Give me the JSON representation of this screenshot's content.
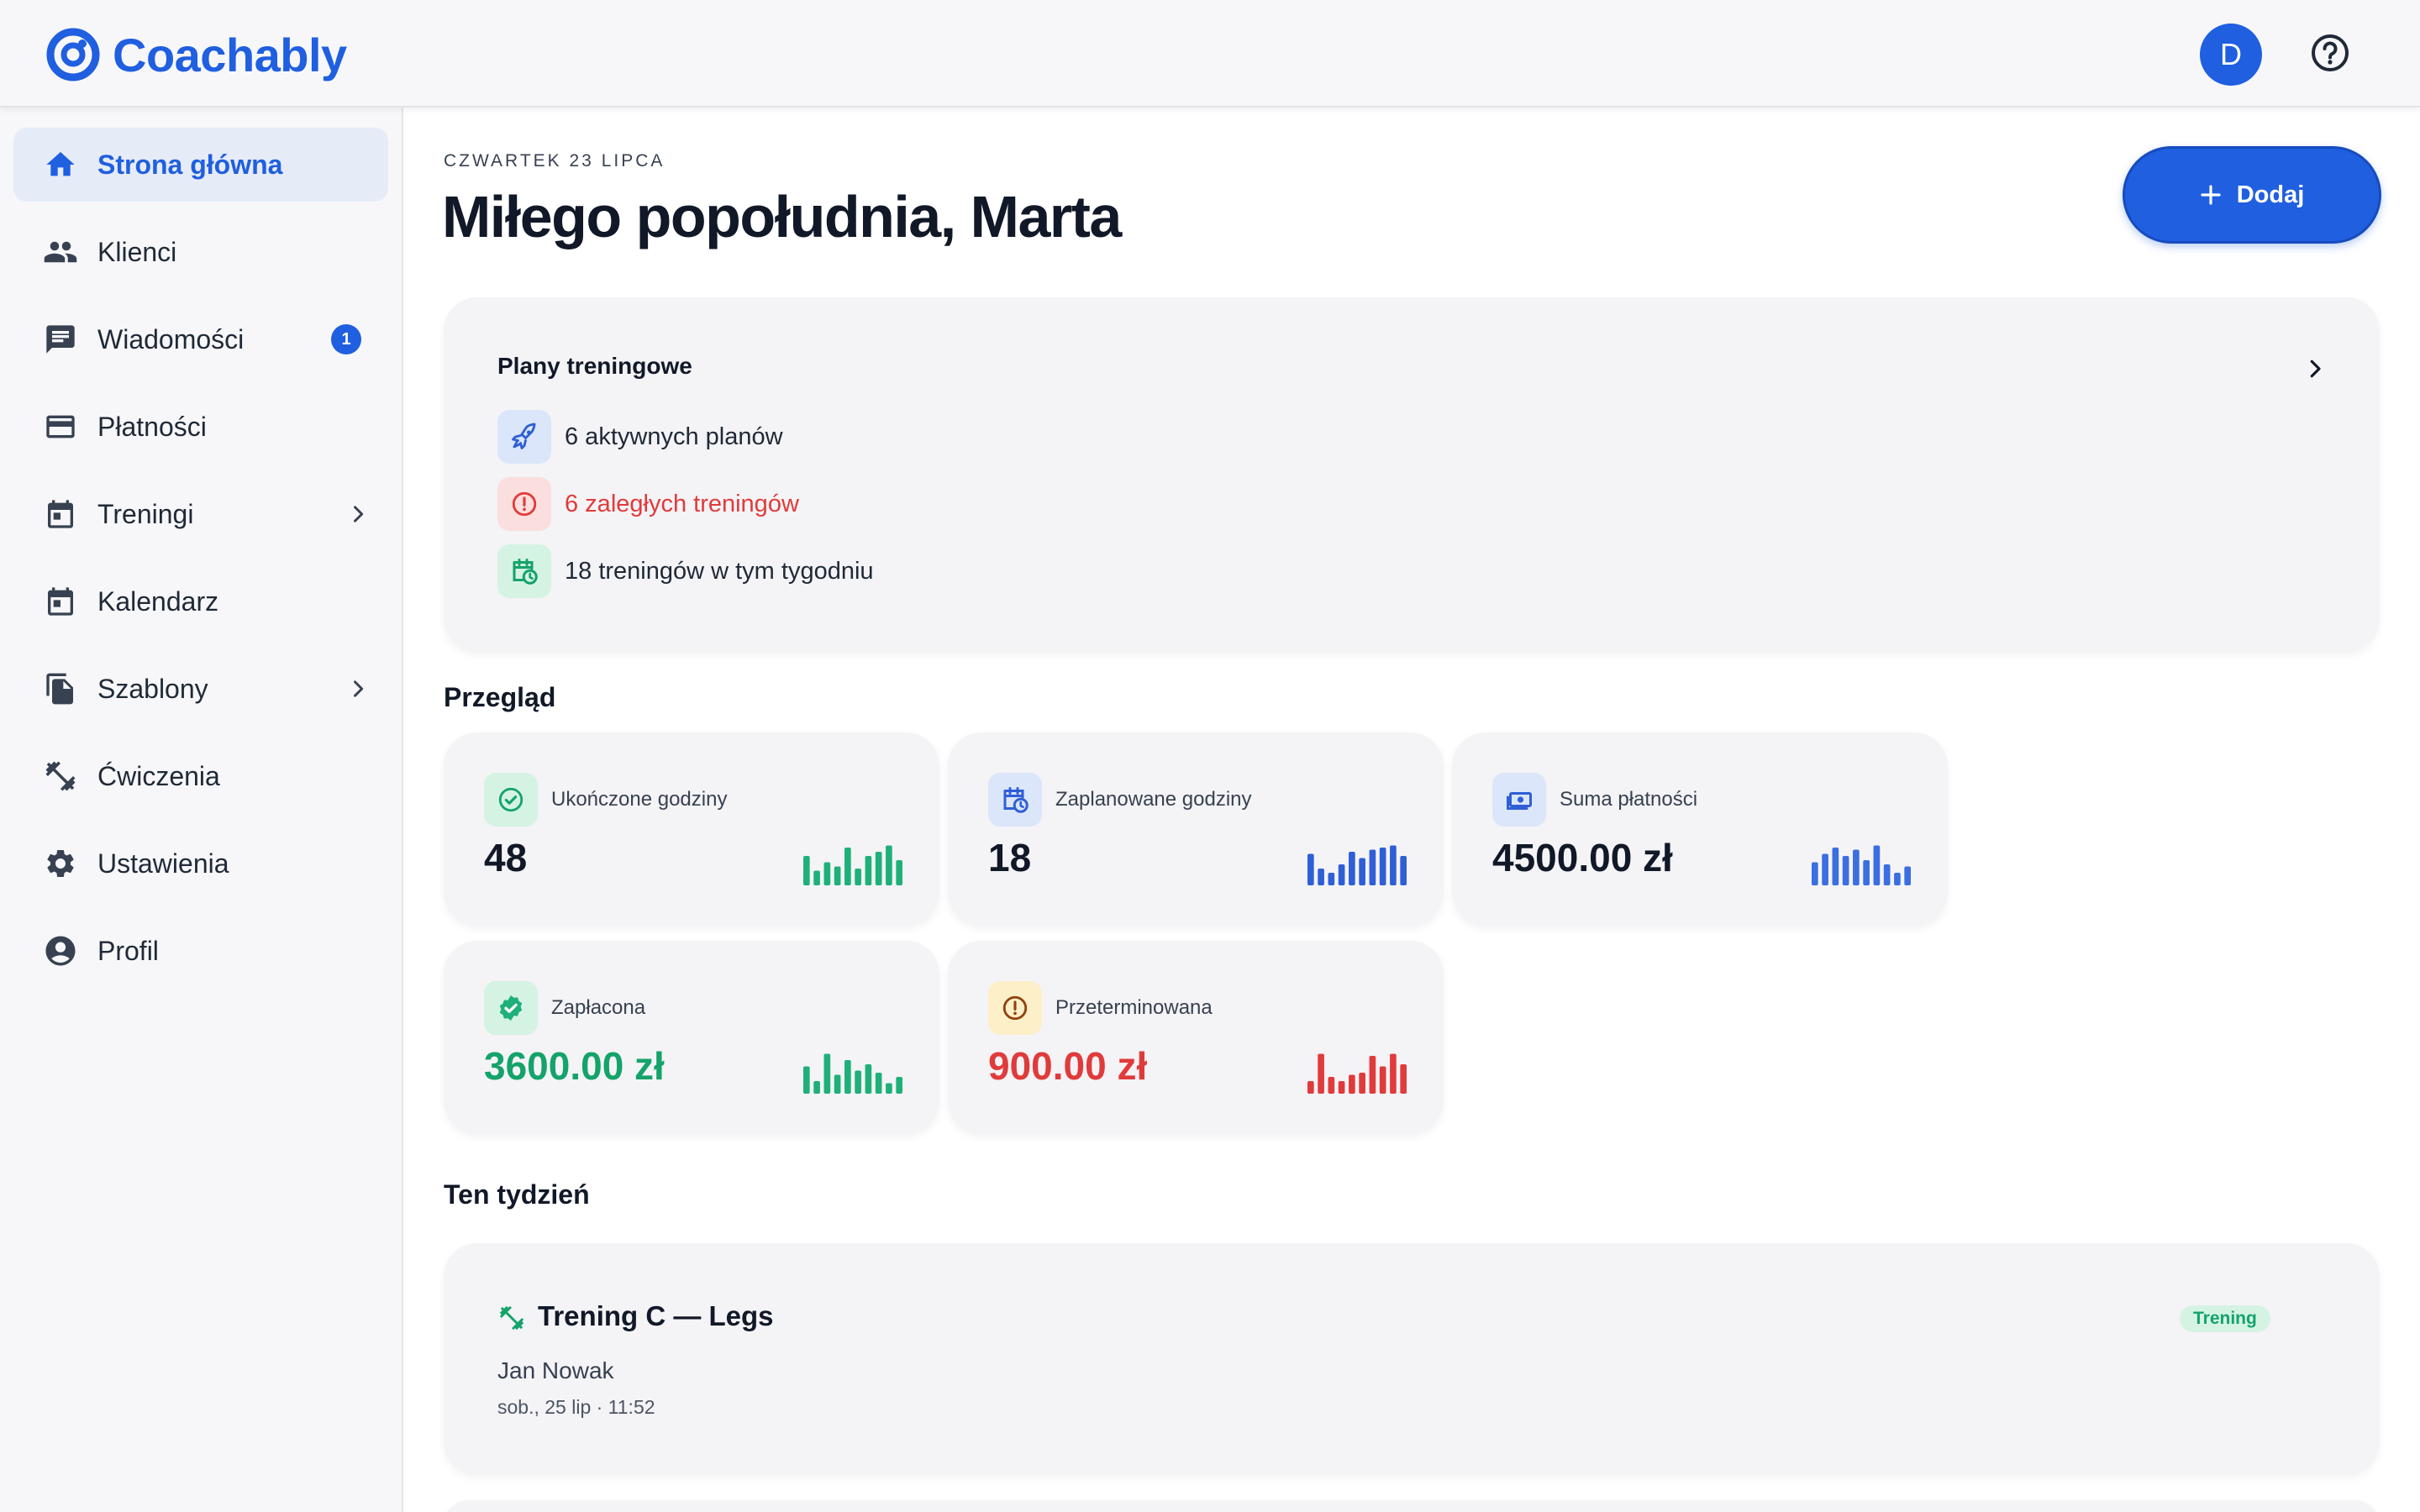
{
  "app": {
    "name": "Coachably",
    "user_initial": "D"
  },
  "colors": {
    "brand": "#1f5fe0",
    "success": "#14a36a",
    "danger": "#e03b3b",
    "warning": "#b45309"
  },
  "sidebar": {
    "items": [
      {
        "label": "Strona główna",
        "icon": "home-icon",
        "active": true
      },
      {
        "label": "Klienci",
        "icon": "people-icon"
      },
      {
        "label": "Wiadomości",
        "icon": "message-icon",
        "badge": "1"
      },
      {
        "label": "Płatności",
        "icon": "credit-card-icon"
      },
      {
        "label": "Treningi",
        "icon": "calendar-icon",
        "expandable": true
      },
      {
        "label": "Kalendarz",
        "icon": "calendar-icon"
      },
      {
        "label": "Szablony",
        "icon": "copy-icon",
        "expandable": true
      },
      {
        "label": "Ćwiczenia",
        "icon": "dumbbell-icon"
      },
      {
        "label": "Ustawienia",
        "icon": "gear-icon"
      },
      {
        "label": "Profil",
        "icon": "account-icon"
      }
    ]
  },
  "header": {
    "date": "CZWARTEK 23 LIPCA",
    "greeting": "Miłego popołudnia, Marta",
    "add_label": "Dodaj"
  },
  "plans": {
    "title": "Plany treningowe",
    "rows": [
      {
        "text": "6 aktywnych planów",
        "icon": "rocket-icon"
      },
      {
        "text": "6 zaległych treningów",
        "icon": "alert-circle-icon"
      },
      {
        "text": "18 treningów w tym tygodniu",
        "icon": "calendar-clock-icon"
      }
    ]
  },
  "overview": {
    "title": "Przegląd",
    "stats": [
      {
        "label": "Ukończone godziny",
        "value": "48",
        "icon": "check-circle-icon",
        "color": "#1fb07a",
        "spark": [
          0.7,
          0.35,
          0.55,
          0.45,
          0.9,
          0.4,
          0.7,
          0.8,
          0.95,
          0.6
        ]
      },
      {
        "label": "Zaplanowane godziny",
        "value": "18",
        "icon": "calendar-clock-icon",
        "color": "#2f5fd6",
        "spark": [
          0.75,
          0.4,
          0.3,
          0.5,
          0.8,
          0.65,
          0.85,
          0.9,
          0.95,
          0.7
        ]
      },
      {
        "label": "Suma płatności",
        "value": "4500.00 zł",
        "icon": "money-icon",
        "color": "#3b6ee0",
        "spark": [
          0.55,
          0.75,
          0.9,
          0.7,
          0.85,
          0.6,
          0.95,
          0.5,
          0.3,
          0.45
        ]
      },
      {
        "label": "Zapłacona",
        "value": "3600.00 zł",
        "icon": "verified-icon",
        "color": "#1fb07a",
        "spark": [
          0.65,
          0.3,
          0.95,
          0.45,
          0.8,
          0.55,
          0.7,
          0.5,
          0.25,
          0.4
        ]
      },
      {
        "label": "Przeterminowana",
        "value": "900.00 zł",
        "icon": "alert-circle-icon",
        "color": "#e03b3b",
        "spark": [
          0.3,
          0.95,
          0.4,
          0.3,
          0.45,
          0.5,
          0.9,
          0.65,
          0.95,
          0.7
        ]
      }
    ]
  },
  "week": {
    "title": "Ten tydzień",
    "events": [
      {
        "title": "Trening C — Legs",
        "client": "Jan Nowak",
        "time": "sob., 25 lip · 11:52",
        "badge": "Trening"
      }
    ]
  }
}
